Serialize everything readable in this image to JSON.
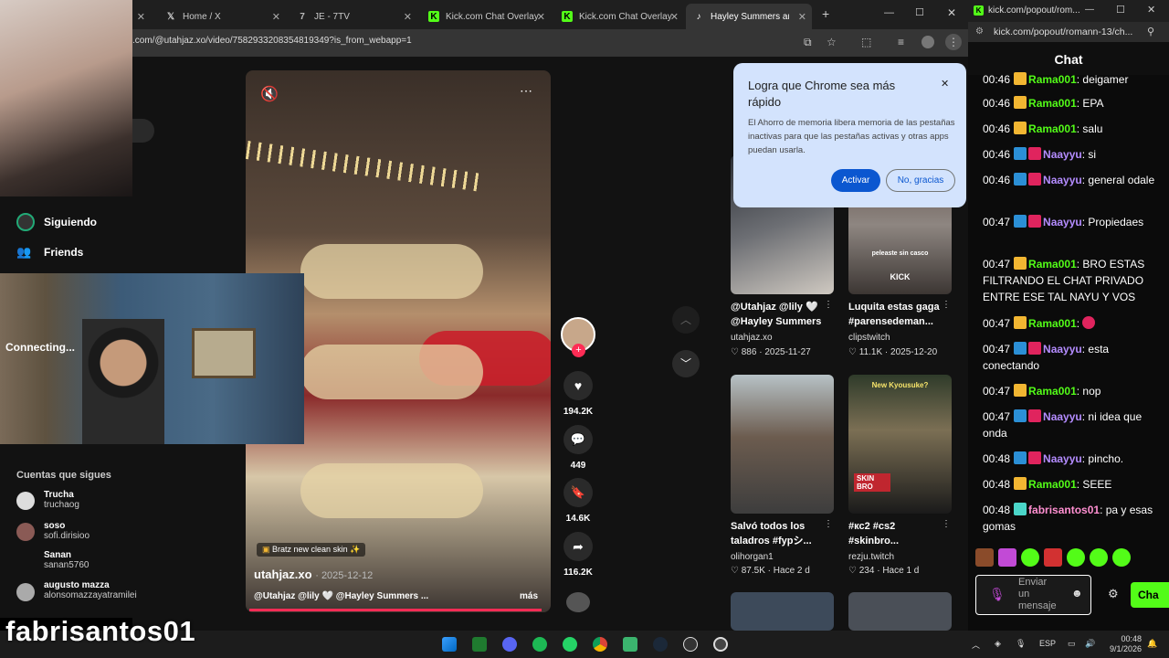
{
  "tabs": [
    {
      "label": "Home / X",
      "icon": "x-logo-icon"
    },
    {
      "label": "JE - 7TV",
      "icon": "7tv-icon"
    },
    {
      "label": "Kick.com Chat Overlay",
      "icon": "kick-icon"
    },
    {
      "label": "Kick.com Chat Overlay",
      "icon": "kick-icon"
    },
    {
      "label": "Hayley Summers and I",
      "icon": "tiktok-icon"
    }
  ],
  "address": ".com/@utahjaz.xo/video/7582933208354819349?is_from_webapp=1",
  "tiktok": {
    "nav_following": "Siguiendo",
    "nav_friends": "Friends",
    "following_header": "Cuentas que sigues",
    "accounts": [
      {
        "name": "Trucha",
        "handle": "truchaog"
      },
      {
        "name": "soso",
        "handle": "sofi.dirisioo"
      },
      {
        "name": "Sanan",
        "handle": "sanan5760"
      },
      {
        "name": "augusto mazza",
        "handle": "alonsomazzayatramilei"
      }
    ],
    "video": {
      "sticker": "Bratz new clean skin",
      "author": "utahjaz.xo",
      "date": "2025-12-12",
      "caption": "@Utahjaz @lily 🤍 @Hayley Summers ...",
      "more": "más"
    },
    "actions": {
      "likes": "194.2K",
      "comments": "449",
      "saves": "14.6K",
      "shares": "116.2K"
    },
    "related": [
      {
        "title": "@Utahjaz @lily 🤍 @Hayley Summers",
        "author": "utahjaz.xo",
        "likes": "886",
        "date": "2025-11-27"
      },
      {
        "title": "Luquita estas gaga #parensedeman...",
        "author": "clipstwitch",
        "likes": "11.1K",
        "date": "2025-12-20",
        "overlay": "peleaste sin casco",
        "overlay2": "KICK"
      },
      {
        "title": "Salvó todos los taladros #fypシ...",
        "author": "olihorgan1",
        "likes": "87.5K",
        "date": "Hace 2 d"
      },
      {
        "title": "#кс2 #cs2 #skinbro...",
        "author": "rezju.twitch",
        "likes": "234",
        "date": "Hace 1 d",
        "overlay": "New Kyousuke?",
        "overlay2": "SKIN BRO"
      }
    ]
  },
  "popup": {
    "title": "Logra que Chrome sea más rápido",
    "body": "El Ahorro de memoria libera memoria de las pestañas inactivas para que las pestañas activas y otras apps puedan usarla.",
    "primary": "Activar",
    "secondary": "No, gracias"
  },
  "webcam": {
    "status": "Connecting..."
  },
  "streamer_name": "fabrisantos01",
  "chat": {
    "window_url": "kick.com/popout/rom...",
    "address": "kick.com/popout/romann-13/ch...",
    "title": "Chat",
    "messages": [
      {
        "time": "00:46",
        "user": "Rama001",
        "text": "deigamer",
        "badges": [
          "yel"
        ],
        "color": "green"
      },
      {
        "time": "00:46",
        "user": "Rama001",
        "text": "EPA",
        "badges": [
          "yel"
        ],
        "color": "green"
      },
      {
        "time": "00:46",
        "user": "Rama001",
        "text": "salu",
        "badges": [
          "yel"
        ],
        "color": "green"
      },
      {
        "time": "00:46",
        "user": "Naayyu",
        "text": "si",
        "badges": [
          "blue",
          "pink"
        ],
        "color": "purple"
      },
      {
        "time": "00:46",
        "user": "Naayyu",
        "text": "general odale",
        "badges": [
          "blue",
          "pink"
        ],
        "color": "purple"
      },
      {
        "time": "00:47",
        "user": "Naayyu",
        "text": "Propiedaes",
        "badges": [
          "blue",
          "pink"
        ],
        "color": "purple"
      },
      {
        "time": "00:47",
        "user": "Rama001",
        "text": "BRO ESTAS FILTRANDO EL CHAT PRIVADO ENTRE ESE TAL NAYU Y VOS",
        "badges": [
          "yel"
        ],
        "color": "green"
      },
      {
        "time": "00:47",
        "user": "Rama001",
        "text": "",
        "badges": [
          "yel"
        ],
        "color": "green",
        "emote": true
      },
      {
        "time": "00:47",
        "user": "Naayyu",
        "text": "esta conectando",
        "badges": [
          "blue",
          "pink"
        ],
        "color": "purple"
      },
      {
        "time": "00:47",
        "user": "Rama001",
        "text": "nop",
        "badges": [
          "yel"
        ],
        "color": "green"
      },
      {
        "time": "00:47",
        "user": "Naayyu",
        "text": "ni idea que onda",
        "badges": [
          "blue",
          "pink"
        ],
        "color": "purple"
      },
      {
        "time": "00:48",
        "user": "Naayyu",
        "text": "pincho.",
        "badges": [
          "blue",
          "pink"
        ],
        "color": "purple"
      },
      {
        "time": "00:48",
        "user": "Rama001",
        "text": "SEEE",
        "badges": [
          "yel"
        ],
        "color": "green"
      },
      {
        "time": "00:48",
        "user": "fabrisantos01",
        "text": "pa y esas gomas",
        "badges": [
          "cyan"
        ],
        "color": "pink2"
      }
    ],
    "input_placeholder": "Enviar un mensaje",
    "send": "Cha"
  },
  "taskbar": {
    "lang": "ESP",
    "time": "00:48",
    "date": "9/1/2026"
  },
  "colors": {
    "kick_green": "#53fc18",
    "tiktok_red": "#fe2c55",
    "popup_bg": "#d3e3fd",
    "popup_btn": "#0b57d0"
  }
}
